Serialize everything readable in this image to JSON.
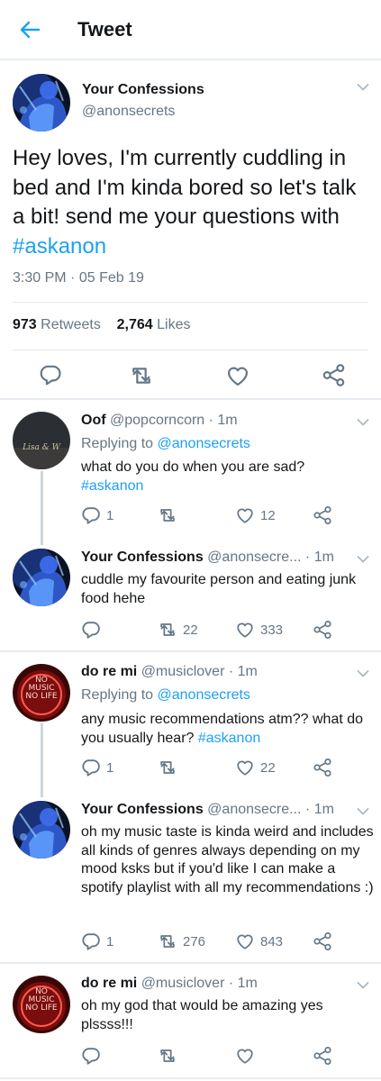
{
  "header": {
    "title": "Tweet"
  },
  "main_tweet": {
    "name": "Your Confessions",
    "handle": "@anonsecrets",
    "text_before": "Hey loves, I'm currently cuddling in bed and I'm kinda bored so let's talk a bit! send me your questions with ",
    "hashtag": "#askanon",
    "time": "3:30 PM",
    "dot": "·",
    "date": "05 Feb 19",
    "retweets": "973",
    "retweets_label": "Retweets",
    "likes": "2,764",
    "likes_label": "Likes"
  },
  "replies": [
    {
      "name": "Oof",
      "handle": "@popcorncorn · 1m",
      "replying_label": "Replying to ",
      "replying_to": "@anonsecrets",
      "text": "what do you do when you are sad?",
      "hashtag": "#askanon",
      "replies": "1",
      "retweets": "",
      "likes": "12",
      "avatar_text": "Lisa & W"
    },
    {
      "name": "Your Confessions",
      "handle": "@anonsecre... · 1m",
      "text": "cuddle my favourite person and eating junk food hehe",
      "replies": "",
      "retweets": "22",
      "likes": "333"
    },
    {
      "name": "do re mi",
      "handle": "@musiclover · 1m",
      "replying_label": "Replying to ",
      "replying_to": "@anonsecrets",
      "text": "any music recommendations atm?? what do you usually hear? ",
      "hashtag": "#askanon",
      "replies": "1",
      "retweets": "",
      "likes": "22",
      "avatar_text": "NO MUSIC NO LIFE"
    },
    {
      "name": "Your Confessions",
      "handle": "@anonsecre... · 1m",
      "text": "oh my music taste is kinda weird and includes all kinds of genres always depending on my mood ksks but if you'd like I can make a spotify playlist with all my recommendations :)",
      "replies": "1",
      "retweets": "276",
      "likes": "843"
    },
    {
      "name": "do re mi",
      "handle": "@musiclover · 1m",
      "text": "oh my god that would be amazing yes plssss!!!",
      "replies": "",
      "retweets": "",
      "likes": "",
      "avatar_text": "NO MUSIC NO LIFE"
    }
  ],
  "colors": {
    "accent": "#1da1f2",
    "text": "#14171a",
    "secondary": "#657786",
    "divider": "#e6ecf0"
  },
  "icons": {
    "back": "arrow-left",
    "reply": "speech-bubble",
    "retweet": "two-arrows-loop",
    "like": "heart",
    "share": "share-nodes",
    "more": "chevron-down"
  }
}
